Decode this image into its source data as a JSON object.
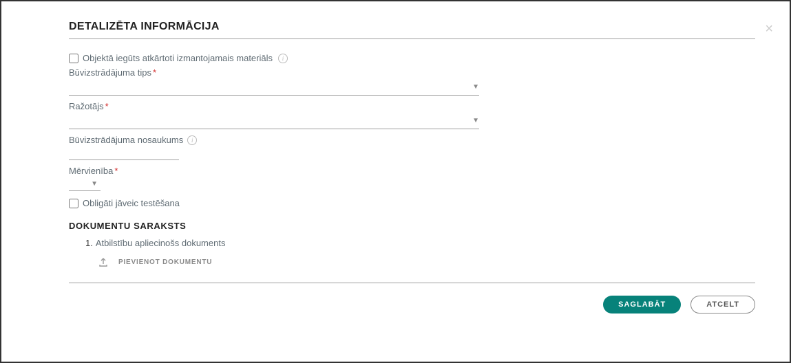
{
  "modal": {
    "title": "DETALIZĒTA INFORMĀCIJA"
  },
  "fields": {
    "recycled_checkbox_label": "Objektā iegūts atkārtoti izmantojamais materiāls",
    "product_type_label": "Būvizstrādājuma tips",
    "manufacturer_label": "Ražotājs",
    "product_name_label": "Būvizstrādājuma nosaukums",
    "unit_label": "Mērvienība",
    "testing_checkbox_label": "Obligāti jāveic testēšana"
  },
  "docs": {
    "heading": "DOKUMENTU SARAKSTS",
    "item1_num": "1.",
    "item1_label": "Atbilstību apliecinošs dokuments",
    "upload_label": "PIEVIENOT DOKUMENTU"
  },
  "actions": {
    "save": "SAGLABĀT",
    "cancel": "ATCELT"
  }
}
